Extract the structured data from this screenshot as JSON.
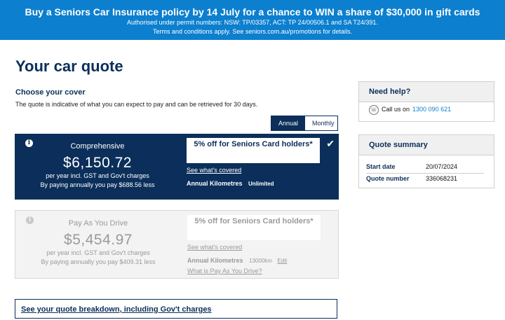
{
  "promo": {
    "headline": "Buy a Seniors Car Insurance policy by 14 July for a chance to WIN a share of $30,000 in gift cards",
    "permits": "Authorised under permit numbers: NSW: TP/03357, ACT: TP 24/00506.1 and SA T24/391.",
    "terms": "Terms and conditions apply. See seniors.com.au/promotions for details."
  },
  "page": {
    "title": "Your car quote",
    "choose_heading": "Choose your cover",
    "description": "The quote is indicative of what you can expect to pay and can be retrieved for 30 days."
  },
  "toggle": {
    "annual": "Annual",
    "monthly": "Monthly",
    "selected": "Annual"
  },
  "options": [
    {
      "name": "Comprehensive",
      "price": "$6,150.72",
      "per_year": "per year incl. GST and Gov't charges",
      "saving": "By paying annually you pay $688.56 less",
      "badge": "5% off for Seniors Card holders*",
      "covered_link": "See what's covered",
      "km_label": "Annual Kilometres",
      "km_value": "Unlimited",
      "selected": true
    },
    {
      "name": "Pay As You Drive",
      "price": "$5,454.97",
      "per_year": "per year incl. GST and Gov't charges",
      "saving": "By paying annually you pay $409.31 less",
      "badge": "5% off for Seniors Card holders*",
      "covered_link": "See what's covered",
      "km_label": "Annual Kilometres",
      "km_value": "13000km",
      "edit": "Edit",
      "payd_link": "What is Pay As You Drive?",
      "selected": false
    }
  ],
  "breakdown_link": "See your quote breakdown, including Gov't charges",
  "help": {
    "title": "Need help?",
    "call_label": "Call us on",
    "phone": "1300 090 621"
  },
  "summary": {
    "title": "Quote summary",
    "start_date_label": "Start date",
    "start_date": "20/07/2024",
    "quote_number_label": "Quote number",
    "quote_number": "336068231"
  },
  "colors": {
    "navy": "#0b2f5a",
    "banner_blue": "#0c7fcf",
    "disabled_gray": "#9a9a9a"
  }
}
